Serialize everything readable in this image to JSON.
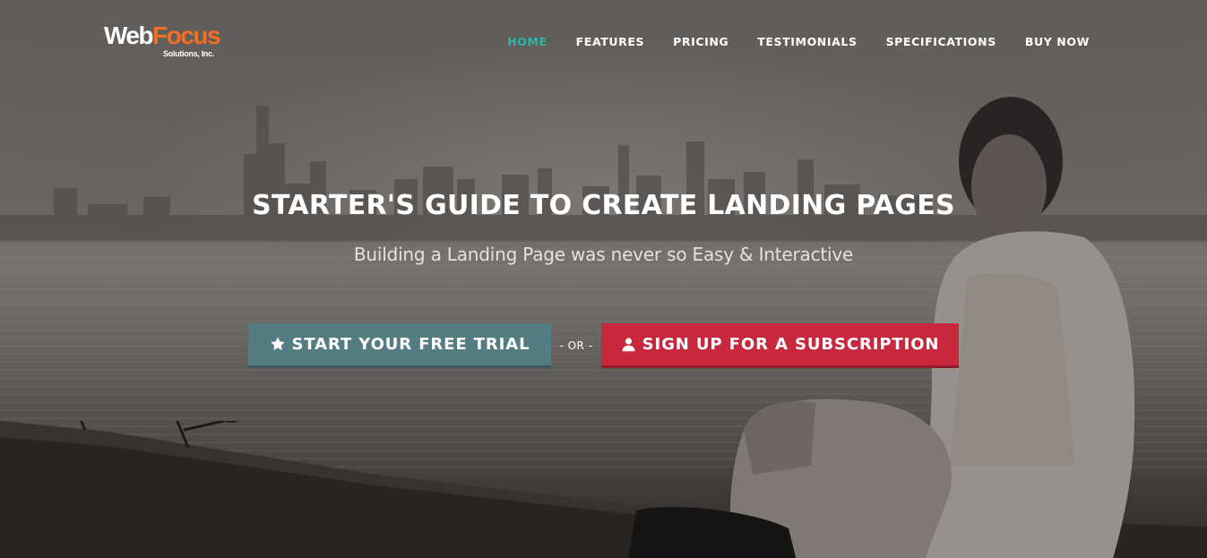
{
  "brand": {
    "logo_web": "Web",
    "logo_focus": "Focus",
    "logo_sub": "Solutions, Inc."
  },
  "nav": {
    "items": [
      {
        "label": "HOME",
        "active": true
      },
      {
        "label": "FEATURES",
        "active": false
      },
      {
        "label": "PRICING",
        "active": false
      },
      {
        "label": "TESTIMONIALS",
        "active": false
      },
      {
        "label": "SPECIFICATIONS",
        "active": false
      },
      {
        "label": "BUY NOW",
        "active": false
      }
    ]
  },
  "hero": {
    "title": "STARTER'S GUIDE TO CREATE LANDING PAGES",
    "subtitle": "Building a Landing Page was never so Easy & Interactive",
    "cta_trial": "START YOUR FREE TRIAL",
    "cta_trial_icon": "star-icon",
    "separator": "- OR -",
    "cta_subscribe": "SIGN UP FOR A SUBSCRIPTION",
    "cta_subscribe_icon": "user-icon"
  },
  "colors": {
    "active_nav": "#2bb6a5",
    "trial_button": "#547d81",
    "subscribe_button": "#c7283e",
    "logo_accent": "#f26f21"
  }
}
